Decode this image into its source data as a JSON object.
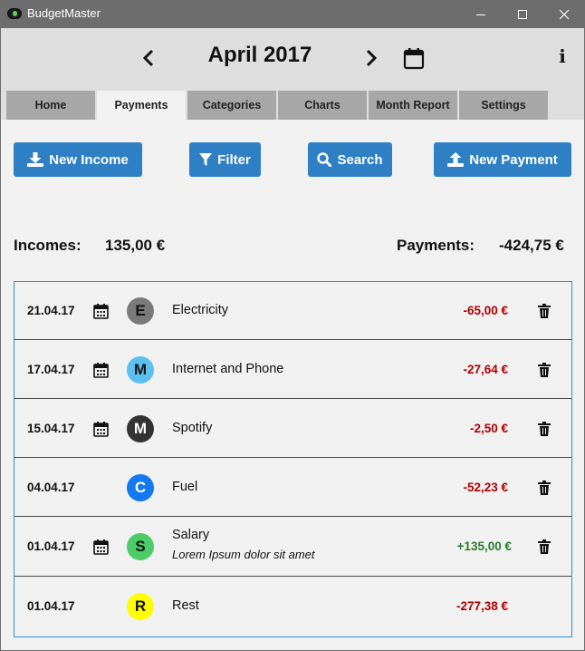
{
  "window": {
    "title": "BudgetMaster"
  },
  "header": {
    "month_title": "April 2017"
  },
  "tabs": [
    {
      "label": "Home",
      "active": false
    },
    {
      "label": "Payments",
      "active": true
    },
    {
      "label": "Categories",
      "active": false
    },
    {
      "label": "Charts",
      "active": false
    },
    {
      "label": "Month Report",
      "active": false
    },
    {
      "label": "Settings",
      "active": false
    }
  ],
  "toolbar": {
    "new_income_label": "New Income",
    "filter_label": "Filter",
    "search_label": "Search",
    "new_payment_label": "New Payment"
  },
  "summary": {
    "incomes_label": "Incomes:",
    "incomes_value": "135,00 €",
    "payments_label": "Payments:",
    "payments_value": "-424,75 €"
  },
  "colors": {
    "accent": "#2f7fc5",
    "negative": "#b00000",
    "positive": "#2a7a2a"
  },
  "payments": [
    {
      "date": "21.04.17",
      "repeating": true,
      "badge": "E",
      "badge_color": "#7a7a7a",
      "badge_text_color": "#111111",
      "name": "Electricity",
      "description": "",
      "amount": "-65,00 €",
      "sign": "neg",
      "deletable": true
    },
    {
      "date": "17.04.17",
      "repeating": true,
      "badge": "M",
      "badge_color": "#5bc0f0",
      "badge_text_color": "#111111",
      "name": "Internet and Phone",
      "description": "",
      "amount": "-27,64 €",
      "sign": "neg",
      "deletable": true
    },
    {
      "date": "15.04.17",
      "repeating": true,
      "badge": "M",
      "badge_color": "#333333",
      "badge_text_color": "#ffffff",
      "name": "Spotify",
      "description": "",
      "amount": "-2,50 €",
      "sign": "neg",
      "deletable": true
    },
    {
      "date": "04.04.17",
      "repeating": false,
      "badge": "C",
      "badge_color": "#1478f0",
      "badge_text_color": "#ffffff",
      "name": "Fuel",
      "description": "",
      "amount": "-52,23 €",
      "sign": "neg",
      "deletable": true
    },
    {
      "date": "01.04.17",
      "repeating": true,
      "badge": "S",
      "badge_color": "#4ccc66",
      "badge_text_color": "#111111",
      "name": "Salary",
      "description": "Lorem Ipsum dolor sit amet",
      "amount": "+135,00 €",
      "sign": "pos",
      "deletable": true
    },
    {
      "date": "01.04.17",
      "repeating": false,
      "badge": "R",
      "badge_color": "#ffff00",
      "badge_text_color": "#111111",
      "name": "Rest",
      "description": "",
      "amount": "-277,38 €",
      "sign": "neg",
      "deletable": false
    }
  ]
}
